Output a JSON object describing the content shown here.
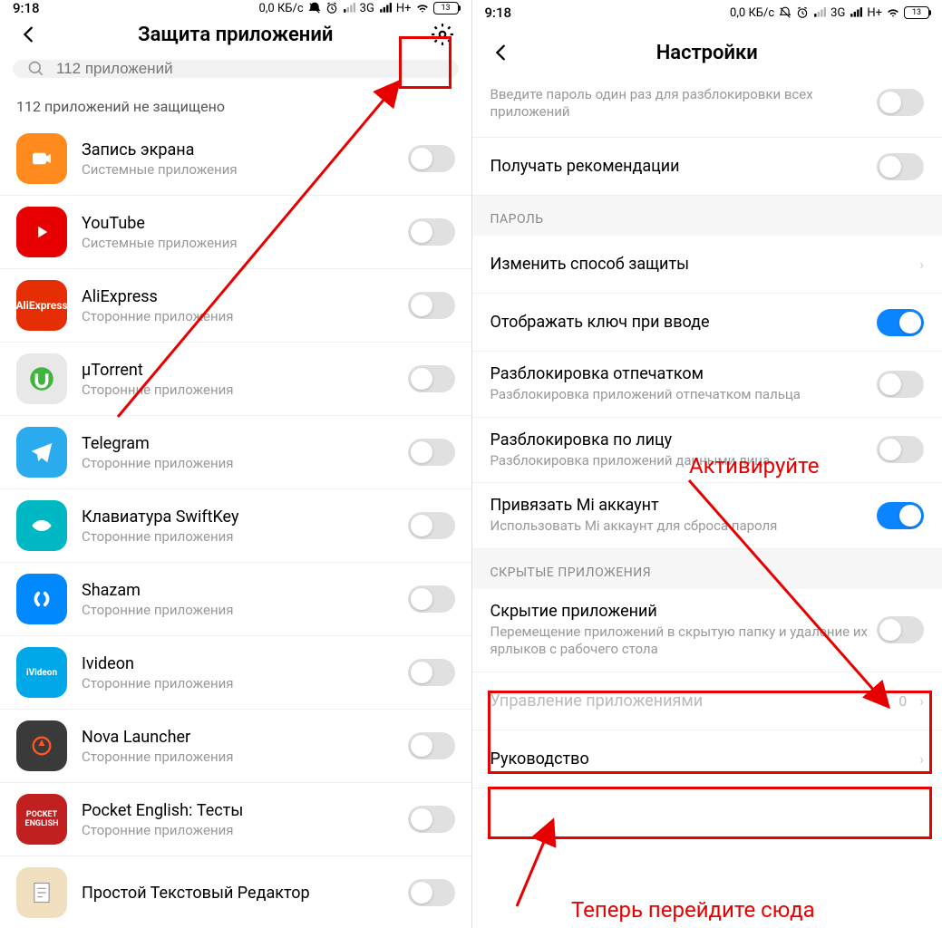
{
  "status": {
    "time": "9:18",
    "data_rate": "0,0 КБ/с",
    "net1": "3G",
    "net2": "H+",
    "battery": "13"
  },
  "left": {
    "title": "Защита приложений",
    "search_placeholder": "112 приложений",
    "unprotected_label": "112 приложений не защищено",
    "apps": [
      {
        "name": "Запись экрана",
        "sub": "Системные приложения",
        "color": "#ff8a1e",
        "icon": "camera"
      },
      {
        "name": "YouTube",
        "sub": "Системные приложения",
        "color": "#e60000",
        "icon": "youtube"
      },
      {
        "name": "AliExpress",
        "sub": "Сторонние приложения",
        "color": "#e62e04",
        "icon": "ali"
      },
      {
        "name": "μTorrent",
        "sub": "Сторонние приложения",
        "color": "#e8e8e8",
        "icon": "utorrent"
      },
      {
        "name": "Telegram",
        "sub": "Сторонние приложения",
        "color": "#2aabee",
        "icon": "telegram"
      },
      {
        "name": "Клавиатура SwiftKey",
        "sub": "Сторонние приложения",
        "color": "#00b8c4",
        "icon": "swiftkey"
      },
      {
        "name": "Shazam",
        "sub": "Сторонние приложения",
        "color": "#0088ff",
        "icon": "shazam"
      },
      {
        "name": "Ivideon",
        "sub": "Сторонние приложения",
        "color": "#00a8e8",
        "icon": "ivideon"
      },
      {
        "name": "Nova Launcher",
        "sub": "Сторонние приложения",
        "color": "#3a3a3a",
        "icon": "nova"
      },
      {
        "name": "Pocket English: Тесты",
        "sub": "Сторонние приложения",
        "color": "#c02020",
        "icon": "pocket"
      },
      {
        "name": "Простой Текстовый Редактор",
        "sub": "",
        "color": "#f0e0c0",
        "icon": "text"
      }
    ]
  },
  "right": {
    "title": "Настройки",
    "top_partial_sub": "Введите пароль один раз для разблокировки всех приложений",
    "recommendations": "Получать рекомендации",
    "section_password": "ПАРОЛЬ",
    "change_method": "Изменить способ защиты",
    "show_key": "Отображать ключ при вводе",
    "fingerprint_title": "Разблокировка отпечатком",
    "fingerprint_sub": "Разблокировка приложений отпечатком пальца",
    "face_title": "Разблокировка по лицу",
    "face_sub": "Разблокировка приложений данными лица",
    "mi_title": "Привязать Mi аккаунт",
    "mi_sub": "Использовать Mi аккаунт для сброса пароля",
    "section_hidden": "СКРЫТЫЕ ПРИЛОЖЕНИЯ",
    "hide_title": "Скрытие приложений",
    "hide_sub": "Перемещение приложений в скрытую папку и удаление их ярлыков с рабочего стола",
    "manage_title": "Управление приложениями",
    "manage_count": "0",
    "guide": "Руководство"
  },
  "annotations": {
    "activate": "Активируйте",
    "go_here": "Теперь перейдите сюда"
  }
}
